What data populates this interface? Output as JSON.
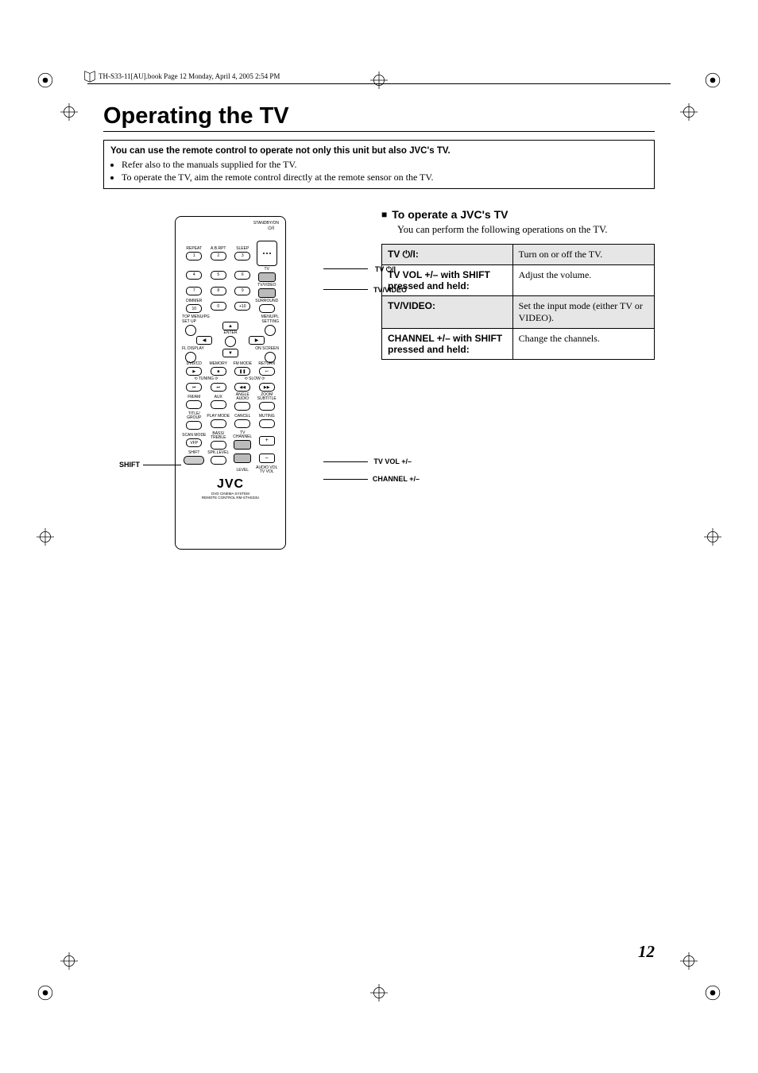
{
  "header": {
    "running_head": "TH-S33-11[AU].book  Page 12  Monday, April 4, 2005  2:54 PM"
  },
  "title": "Operating the TV",
  "intro": {
    "lead": "You can use the remote control to operate not only this unit but also JVC's TV.",
    "bullets": [
      "Refer also to the manuals supplied for the TV.",
      "To operate the TV, aim the remote control directly at the remote sensor on the TV."
    ]
  },
  "section": {
    "heading": "To operate a JVC's TV",
    "sub": "You can perform the following operations on the TV."
  },
  "table": {
    "rows": [
      {
        "key_prefix": "TV ",
        "key_icon": "⏻/I",
        "key_suffix": ":",
        "desc": "Turn on or off the TV."
      },
      {
        "key": "TV VOL +/– with SHIFT pressed and held:",
        "desc": "Adjust the volume."
      },
      {
        "key": "TV/VIDEO:",
        "desc": "Set the input mode (either TV or VIDEO)."
      },
      {
        "key": "CHANNEL +/– with SHIFT pressed and held:",
        "desc": "Change the channels."
      }
    ]
  },
  "callouts": {
    "tv_power": "TV ⏻/I",
    "tv_video": "TV/VIDEO",
    "shift": "SHIFT",
    "tv_vol": "TV VOL +/–",
    "channel": "CHANNEL +/–"
  },
  "remote": {
    "standby": "STANDBY/ON",
    "row_labels_1": [
      "REPEAT",
      "A.B.RPT",
      "SLEEP"
    ],
    "tv_label": "TV",
    "tvvideo_label": "TV/VIDEO",
    "dimmer": "DIMMER",
    "surround": "SURROUND",
    "topmenu": "TOP MENU/PG",
    "setup": "SET UP",
    "menupl": "MENU/PL",
    "setting": "SETTING",
    "enter": "ENTER",
    "fl": "FL DISPLAY",
    "onscreen": "ON SCREEN",
    "row4": [
      "DVD/CD",
      "MEMORY",
      "FM MODE",
      "RETURN"
    ],
    "tuning_l": "⟲ TUNING ⟳",
    "slow": "⟲  SLOW  ⟳",
    "row5": [
      "FM/AM",
      "AUX",
      "ANGLE AUDIO",
      "ZOOM SUBTITLE"
    ],
    "row6": [
      "TITLE/ GROUP",
      "PLAY MODE",
      "CANCEL",
      "MUTING"
    ],
    "scanmode": "SCAN MODE",
    "basstreble": "BASS/ TREBLE",
    "vfp": "VFP",
    "shift_label": "SHIFT",
    "spklevel": "SPK.LEVEL",
    "tvchannel": "TV CHANNEL",
    "level": "LEVEL",
    "audiovol": "AUDIO VOL TV VOL",
    "brand": "JVC",
    "brand_sub1": "DVD CINEMA SYSTEM",
    "brand_sub2": "REMOTE CONTROL RM-STHS33U",
    "nums": [
      "1",
      "2",
      "3",
      "4",
      "5",
      "6",
      "7",
      "8",
      "9",
      "10",
      "0",
      "+10"
    ]
  },
  "page_number": "12"
}
